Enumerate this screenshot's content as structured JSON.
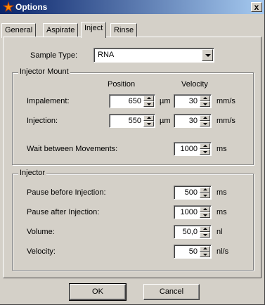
{
  "window": {
    "title": "Options",
    "close_label": "x"
  },
  "tabs": [
    {
      "label": "General"
    },
    {
      "label": "Aspirate"
    },
    {
      "label": "Inject"
    },
    {
      "label": "Rinse"
    }
  ],
  "sample_type": {
    "label": "Sample Type:",
    "value": "RNA"
  },
  "injector_mount": {
    "title": "Injector Mount",
    "position_header": "Position",
    "velocity_header": "Velocity",
    "impalement": {
      "label": "Impalement:",
      "position": "650",
      "position_unit": "µm",
      "velocity": "30",
      "velocity_unit": "mm/s"
    },
    "injection": {
      "label": "Injection:",
      "position": "550",
      "position_unit": "µm",
      "velocity": "30",
      "velocity_unit": "mm/s"
    },
    "wait": {
      "label": "Wait between Movements:",
      "value": "1000",
      "unit": "ms"
    }
  },
  "injector": {
    "title": "Injector",
    "pause_before": {
      "label": "Pause before Injection:",
      "value": "500",
      "unit": "ms"
    },
    "pause_after": {
      "label": "Pause after Injection:",
      "value": "1000",
      "unit": "ms"
    },
    "volume": {
      "label": "Volume:",
      "value": "50,0",
      "unit": "nl"
    },
    "velocity": {
      "label": "Velocity:",
      "value": "50",
      "unit": "nl/s"
    }
  },
  "buttons": {
    "ok": "OK",
    "cancel": "Cancel"
  }
}
